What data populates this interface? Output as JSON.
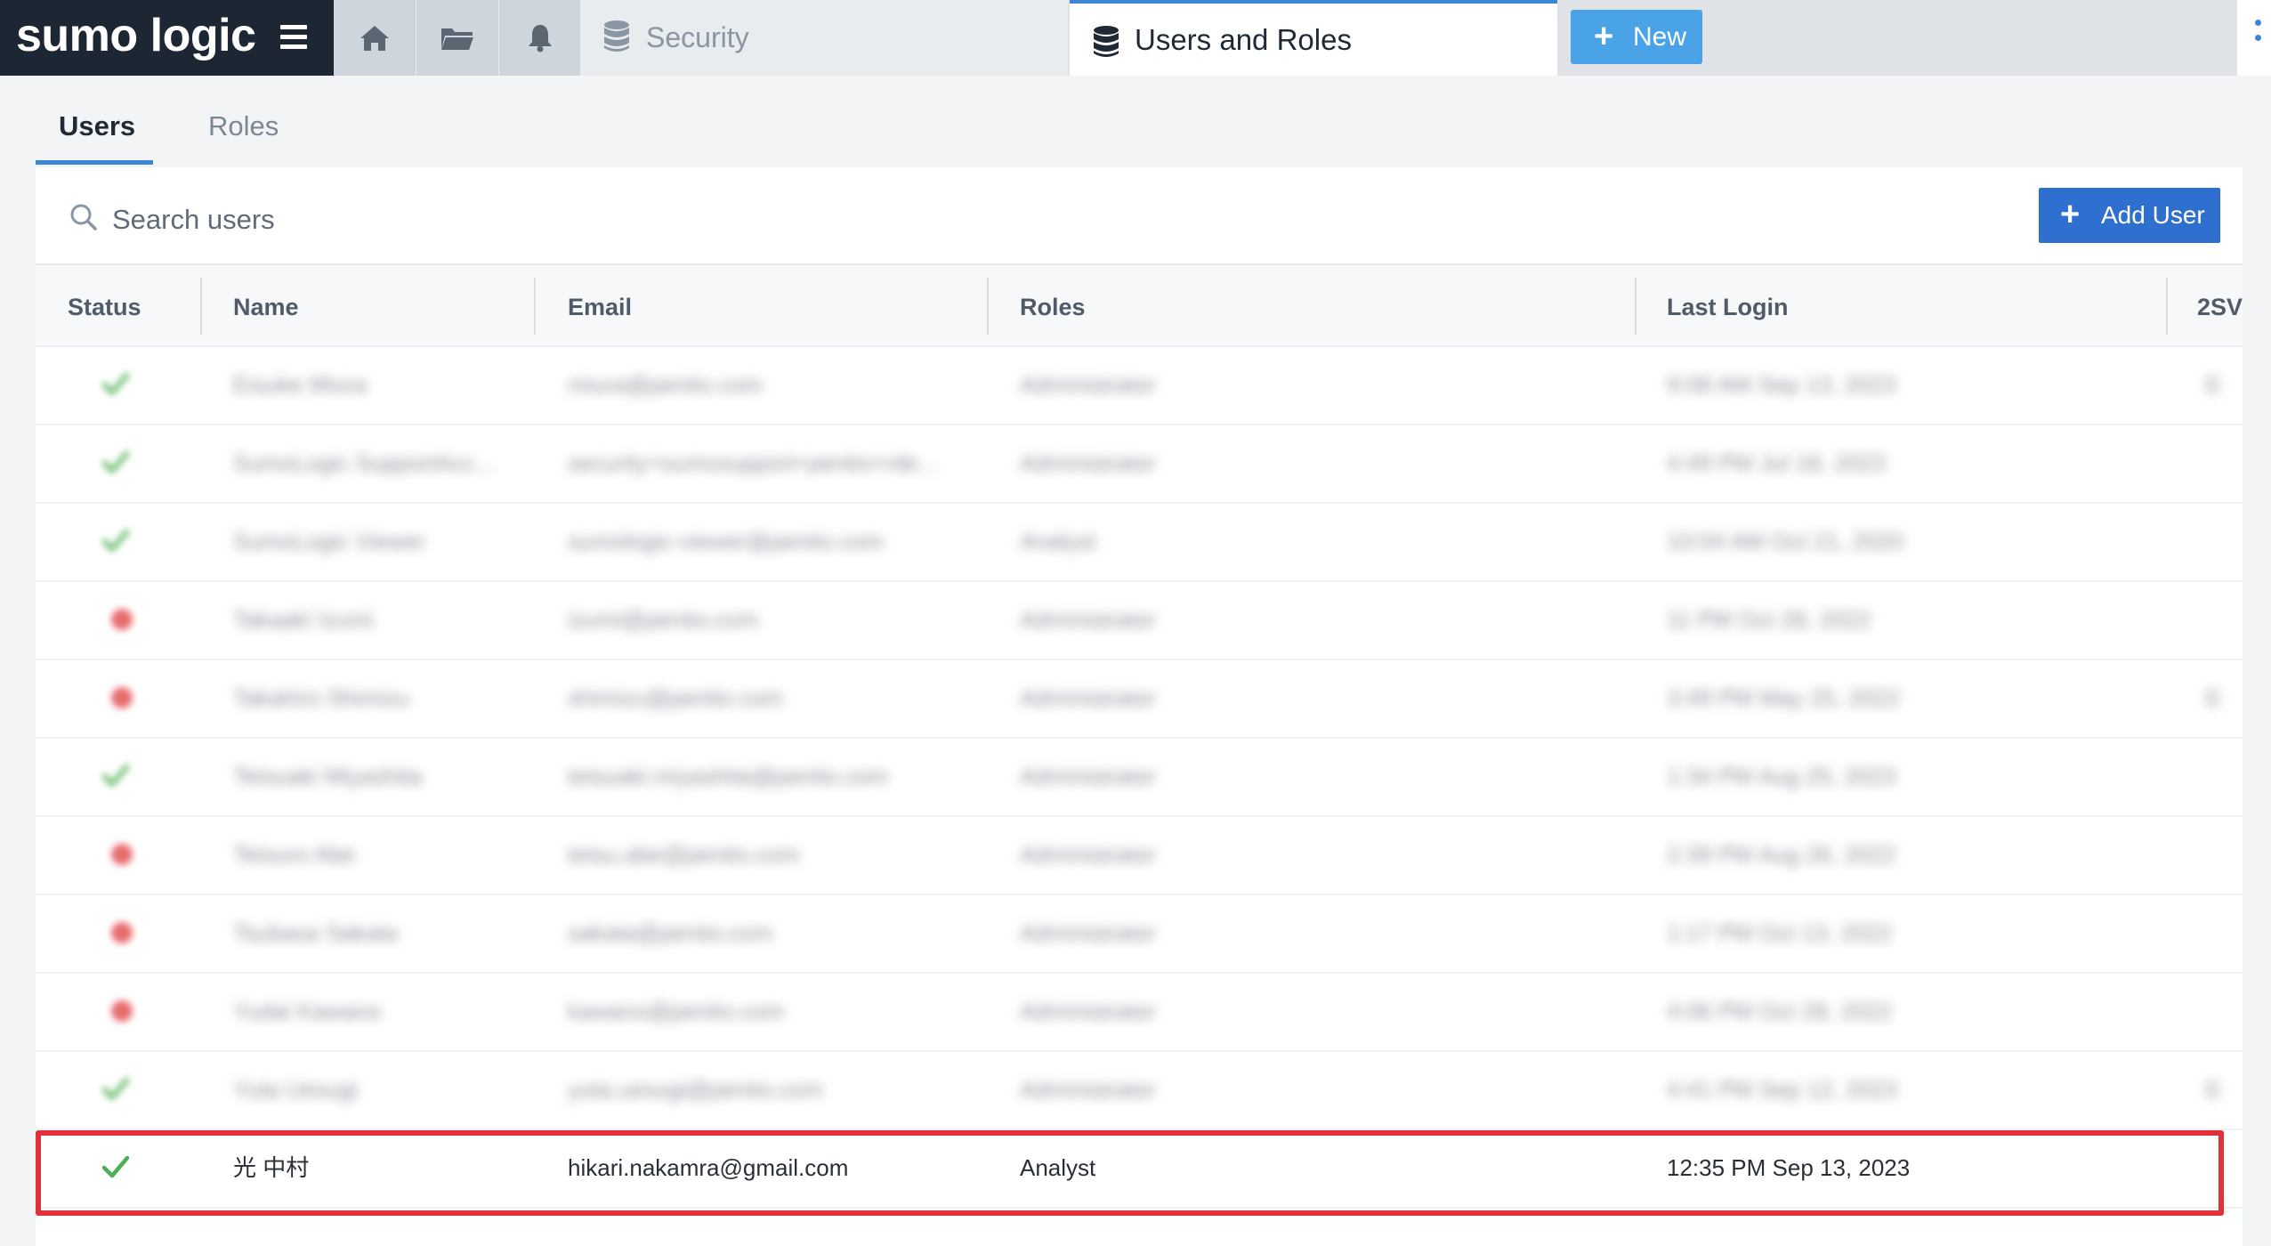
{
  "app": {
    "logo": "sumo logic"
  },
  "topbar": {
    "security_tab": "Security",
    "active_tab": "Users and Roles",
    "new_button": "New"
  },
  "subtabs": [
    "Users",
    "Roles"
  ],
  "search": {
    "placeholder": "Search users"
  },
  "add_user_button": "Add User",
  "table": {
    "headers": [
      "Status",
      "Name",
      "Email",
      "Roles",
      "Last Login",
      "2SV"
    ],
    "rows": [
      {
        "status": "active",
        "name": "Eisuke Miura",
        "email": "miura@pentio.com",
        "role": "Administrator",
        "last_login": "9:08 AM Sep 13, 2023",
        "twosv": "E",
        "blurred": true
      },
      {
        "status": "active",
        "name": "SumoLogic SupportAcc...",
        "email": "security+sumosupport+pentio+rde...",
        "role": "Administrator",
        "last_login": "4:49 PM Jul 18, 2023",
        "twosv": "",
        "blurred": true
      },
      {
        "status": "active",
        "name": "SumoLogic Viewer",
        "email": "sumologic-viewer@pentio.com",
        "role": "Analyst",
        "last_login": "10:04 AM Oct 21, 2020",
        "twosv": "",
        "blurred": true
      },
      {
        "status": "inactive",
        "name": "Takaaki Izumi",
        "email": "izumi@pentio.com",
        "role": "Administrator",
        "last_login": "11 PM Oct 28, 2022",
        "twosv": "",
        "blurred": true
      },
      {
        "status": "inactive",
        "name": "Takahiro Shimizu",
        "email": "shimizu@pentio.com",
        "role": "Administrator",
        "last_login": "3:49 PM May 25, 2022",
        "twosv": "E",
        "blurred": true
      },
      {
        "status": "active",
        "name": "Tetsuaki Miyashita",
        "email": "tetsuaki.miyashita@pentio.com",
        "role": "Administrator",
        "last_login": "1:34 PM Aug 25, 2023",
        "twosv": "",
        "blurred": true
      },
      {
        "status": "inactive",
        "name": "Tetsuro Abe",
        "email": "tetsu.abe@pentio.com",
        "role": "Administrator",
        "last_login": "2:39 PM Aug 26, 2022",
        "twosv": "",
        "blurred": true
      },
      {
        "status": "inactive",
        "name": "Tsubasa Sakata",
        "email": "sakata@pentio.com",
        "role": "Administrator",
        "last_login": "1:17 PM Oct 13, 2022",
        "twosv": "",
        "blurred": true
      },
      {
        "status": "inactive",
        "name": "Yudai Kawano",
        "email": "kawano@pentio.com",
        "role": "Administrator",
        "last_login": "4:06 PM Oct 28, 2022",
        "twosv": "",
        "blurred": true
      },
      {
        "status": "active",
        "name": "Yuta Uesugi",
        "email": "yuta.uesugi@pentio.com",
        "role": "Administrator",
        "last_login": "4:41 PM Sep 12, 2023",
        "twosv": "E",
        "blurred": true
      },
      {
        "status": "active",
        "name": "光 中村",
        "email": "hikari.nakamra@gmail.com",
        "role": "Analyst",
        "last_login": "12:35 PM Sep 13, 2023",
        "twosv": "",
        "blurred": false
      }
    ]
  },
  "colors": {
    "topbar_dark": "#1d2733",
    "accent": "#3c86d8",
    "add_user": "#2e6fd0",
    "check": "#4caf50",
    "inactive": "#e86c6c",
    "highlight": "#e0303a"
  }
}
